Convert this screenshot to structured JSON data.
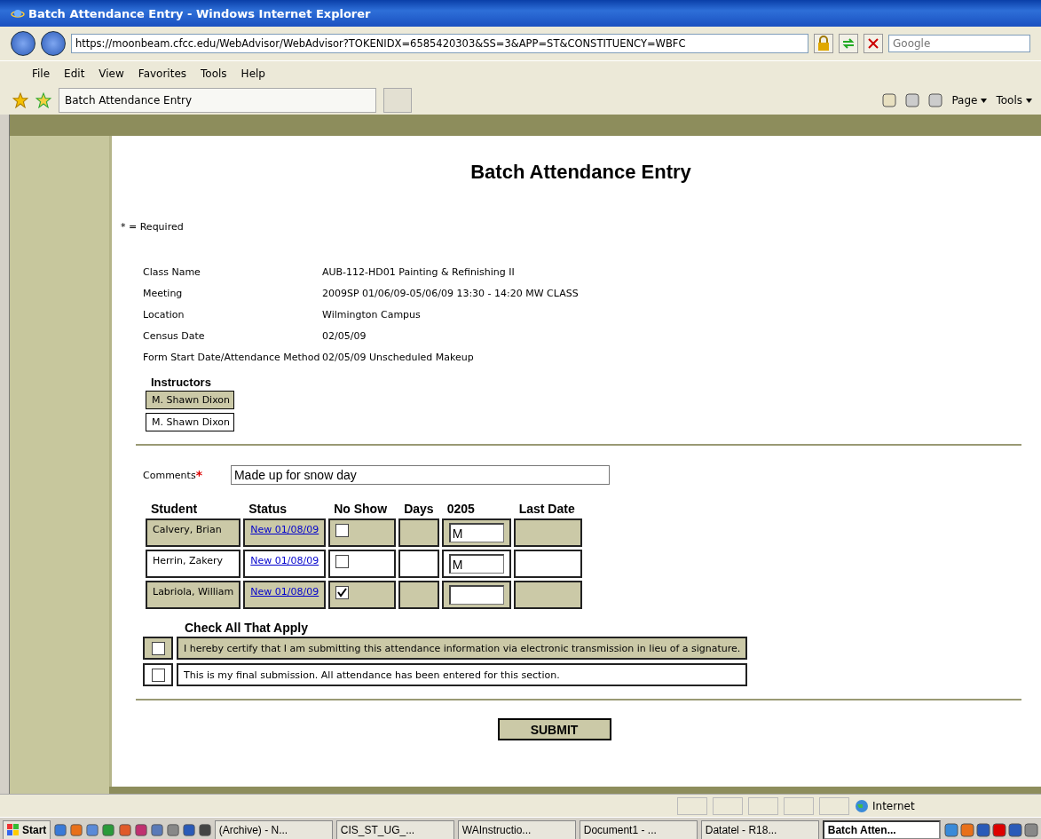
{
  "window": {
    "title": "Batch Attendance Entry - Windows Internet Explorer"
  },
  "address_bar": {
    "url": "https://moonbeam.cfcc.edu/WebAdvisor/WebAdvisor?TOKENIDX=6585420303&SS=3&APP=ST&CONSTITUENCY=WBFC"
  },
  "search": {
    "placeholder": "Google"
  },
  "menu": [
    "File",
    "Edit",
    "View",
    "Favorites",
    "Tools",
    "Help"
  ],
  "tab": {
    "label": "Batch Attendance Entry"
  },
  "command_bar": [
    "Page",
    "Tools"
  ],
  "page": {
    "title": "Batch Attendance Entry",
    "required_note": "* = Required",
    "details": [
      {
        "label": "Class Name",
        "value": "AUB-112-HD01 Painting & Refinishing II"
      },
      {
        "label": "Meeting",
        "value": "2009SP 01/06/09-05/06/09 13:30 - 14:20 MW CLASS"
      },
      {
        "label": "Location",
        "value": "Wilmington Campus"
      },
      {
        "label": "Census Date",
        "value": "02/05/09"
      },
      {
        "label": "Form Start Date/Attendance Method",
        "value": "02/05/09 Unscheduled Makeup"
      }
    ],
    "instructors": {
      "heading": "Instructors",
      "names": [
        "M. Shawn Dixon",
        "M. Shawn Dixon"
      ]
    },
    "comments": {
      "label": "Comments",
      "required_mark": "*",
      "value": "Made up for snow day"
    },
    "table": {
      "columns": [
        "Student",
        "Status",
        "No Show",
        "Days",
        "0205",
        "Last Date"
      ],
      "rows": [
        {
          "student": "Calvery, Brian",
          "status": "New 01/08/09",
          "no_show": false,
          "entry": "M"
        },
        {
          "student": "Herrin, Zakery",
          "status": "New 01/08/09",
          "no_show": false,
          "entry": "M"
        },
        {
          "student": "Labriola, William",
          "status": "New 01/08/09",
          "no_show": true
        }
      ]
    },
    "check_heading": "Check All That Apply",
    "certifications": [
      {
        "text": "I hereby certify that I am submitting this attendance information via electronic transmission in lieu of a signature.",
        "checked": false
      },
      {
        "text": "This is my final submission. All attendance has been entered for this section.",
        "checked": false
      }
    ],
    "submit": "SUBMIT"
  },
  "status_bar": {
    "zone": "Internet"
  },
  "taskbar": {
    "start": "Start",
    "tasks": [
      {
        "label": "(Archive) - N...",
        "selected": false
      },
      {
        "label": "CIS_ST_UG_...",
        "selected": false
      },
      {
        "label": "WAInstructio...",
        "selected": false
      },
      {
        "label": "Document1 - ...",
        "selected": false
      },
      {
        "label": "Datatel - R18...",
        "selected": false
      },
      {
        "label": "Batch Atten...",
        "selected": true
      }
    ]
  }
}
